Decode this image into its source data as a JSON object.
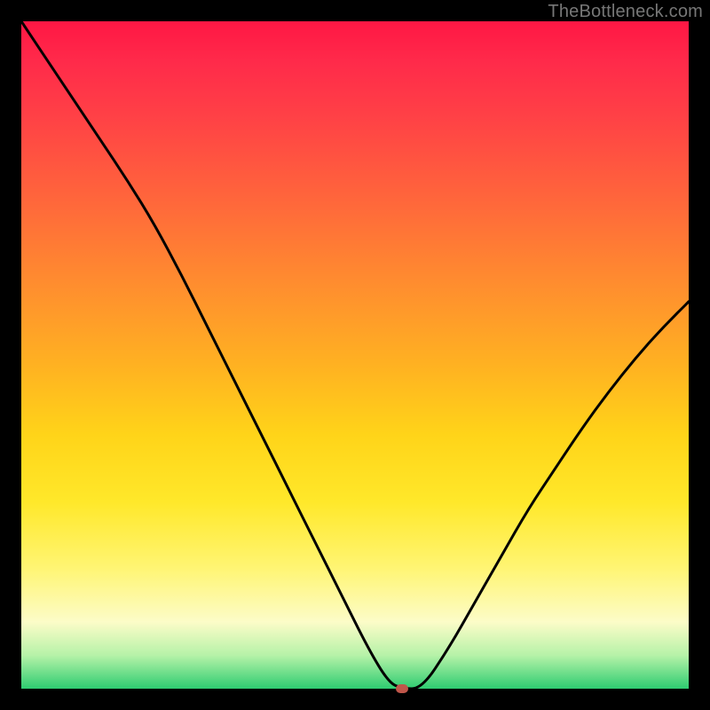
{
  "watermark": "TheBottleneck.com",
  "colors": {
    "frame": "#000000",
    "curve": "#000000",
    "marker": "#c0564a",
    "gradient_top": "#ff1744",
    "gradient_bottom": "#2ecc71"
  },
  "chart_data": {
    "type": "line",
    "title": "",
    "xlabel": "",
    "ylabel": "",
    "xlim": [
      0,
      100
    ],
    "ylim": [
      0,
      100
    ],
    "grid": false,
    "legend": false,
    "x": [
      0,
      4,
      8,
      12,
      16,
      20,
      24,
      28,
      32,
      36,
      40,
      44,
      48,
      52,
      55,
      57,
      60,
      64,
      68,
      72,
      76,
      80,
      84,
      88,
      92,
      96,
      100
    ],
    "values": [
      100,
      94,
      88,
      82,
      76,
      69.5,
      62,
      54,
      46,
      38,
      30,
      22,
      14,
      6,
      1,
      0,
      0,
      6,
      13,
      20,
      27,
      33,
      39,
      44.5,
      49.5,
      54,
      58
    ],
    "annotations": [
      {
        "type": "marker",
        "x": 57,
        "y": 0,
        "shape": "rounded-rect",
        "color": "#c0564a"
      }
    ],
    "notes": "Bottleneck-style V-curve on a red→green heat gradient background. Axes unlabeled. Minimum (flat segment) around x≈55–60 at y≈0."
  }
}
